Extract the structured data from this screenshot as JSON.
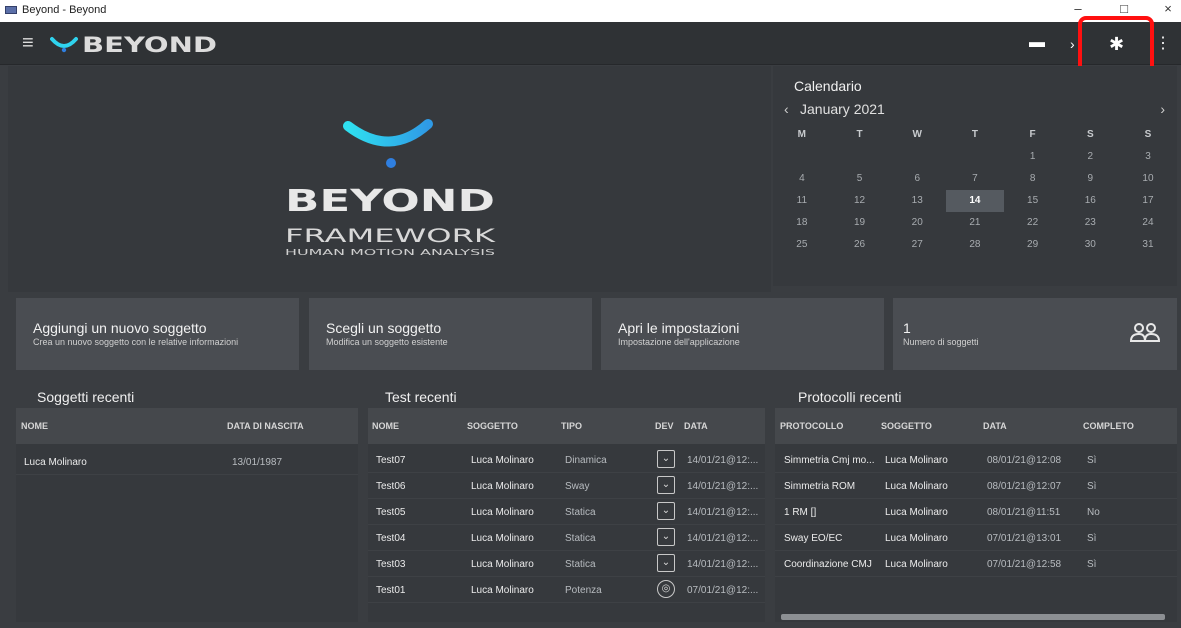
{
  "window": {
    "title": "Beyond - Beyond",
    "minimize": "–",
    "maximize": "□",
    "close": "×"
  },
  "appbar": {
    "brand": "BEYOND"
  },
  "hero": {
    "title": "BEYOND",
    "subtitle": "FRAMEWORK",
    "tagline": "HUMAN MOTION ANALYSIS"
  },
  "calendar": {
    "title": "Calendario",
    "month": "January 2021",
    "weekdays": [
      "M",
      "T",
      "W",
      "T",
      "F",
      "S",
      "S"
    ],
    "weeks": [
      [
        "",
        "",
        "",
        "",
        "1",
        "2",
        "3"
      ],
      [
        "4",
        "5",
        "6",
        "7",
        "8",
        "9",
        "10"
      ],
      [
        "11",
        "12",
        "13",
        "14",
        "15",
        "16",
        "17"
      ],
      [
        "18",
        "19",
        "20",
        "21",
        "22",
        "23",
        "24"
      ],
      [
        "25",
        "26",
        "27",
        "28",
        "29",
        "30",
        "31"
      ]
    ],
    "selected": "14"
  },
  "cards": [
    {
      "title": "Aggiungi un nuovo soggetto",
      "subtitle": "Crea un nuovo soggetto con le relative informazioni"
    },
    {
      "title": "Scegli un soggetto",
      "subtitle": "Modifica un soggetto esistente"
    },
    {
      "title": "Apri le impostazioni",
      "subtitle": "Impostazione dell'applicazione"
    },
    {
      "title": "1",
      "subtitle": "Numero di soggetti"
    }
  ],
  "recent_subjects": {
    "title": "Soggetti recenti",
    "columns": [
      "NOME",
      "DATA DI NASCITA"
    ],
    "rows": [
      [
        "Luca Molinaro",
        "13/01/1987"
      ]
    ]
  },
  "recent_tests": {
    "title": "Test recenti",
    "columns": [
      "NOME",
      "SOGGETTO",
      "TIPO",
      "DEV",
      "DATA"
    ],
    "rows": [
      [
        "Test07",
        "Luca Molinaro",
        "Dinamica",
        "14/01/21@12:..."
      ],
      [
        "Test06",
        "Luca Molinaro",
        "Sway",
        "14/01/21@12:..."
      ],
      [
        "Test05",
        "Luca Molinaro",
        "Statica",
        "14/01/21@12:..."
      ],
      [
        "Test04",
        "Luca Molinaro",
        "Statica",
        "14/01/21@12:..."
      ],
      [
        "Test03",
        "Luca Molinaro",
        "Statica",
        "14/01/21@12:..."
      ],
      [
        "Test01",
        "Luca Molinaro",
        "Potenza",
        "07/01/21@12:..."
      ]
    ]
  },
  "recent_protocols": {
    "title": "Protocolli recenti",
    "columns": [
      "PROTOCOLLO",
      "SOGGETTO",
      "DATA",
      "COMPLETO"
    ],
    "rows": [
      [
        "Simmetria Cmj mo...",
        "Luca Molinaro",
        "08/01/21@12:08",
        "Sì"
      ],
      [
        "Simmetria ROM",
        "Luca Molinaro",
        "08/01/21@12:07",
        "Sì"
      ],
      [
        "1 RM []",
        "Luca Molinaro",
        "08/01/21@11:51",
        "No"
      ],
      [
        "Sway EO/EC",
        "Luca Molinaro",
        "07/01/21@13:01",
        "Sì"
      ],
      [
        "Coordinazione CMJ",
        "Luca Molinaro",
        "07/01/21@12:58",
        "Sì"
      ]
    ]
  },
  "colors": {
    "accent_cyan": "#2fd3ee",
    "accent_blue": "#2f7fe0",
    "highlight": "#ff1010"
  }
}
